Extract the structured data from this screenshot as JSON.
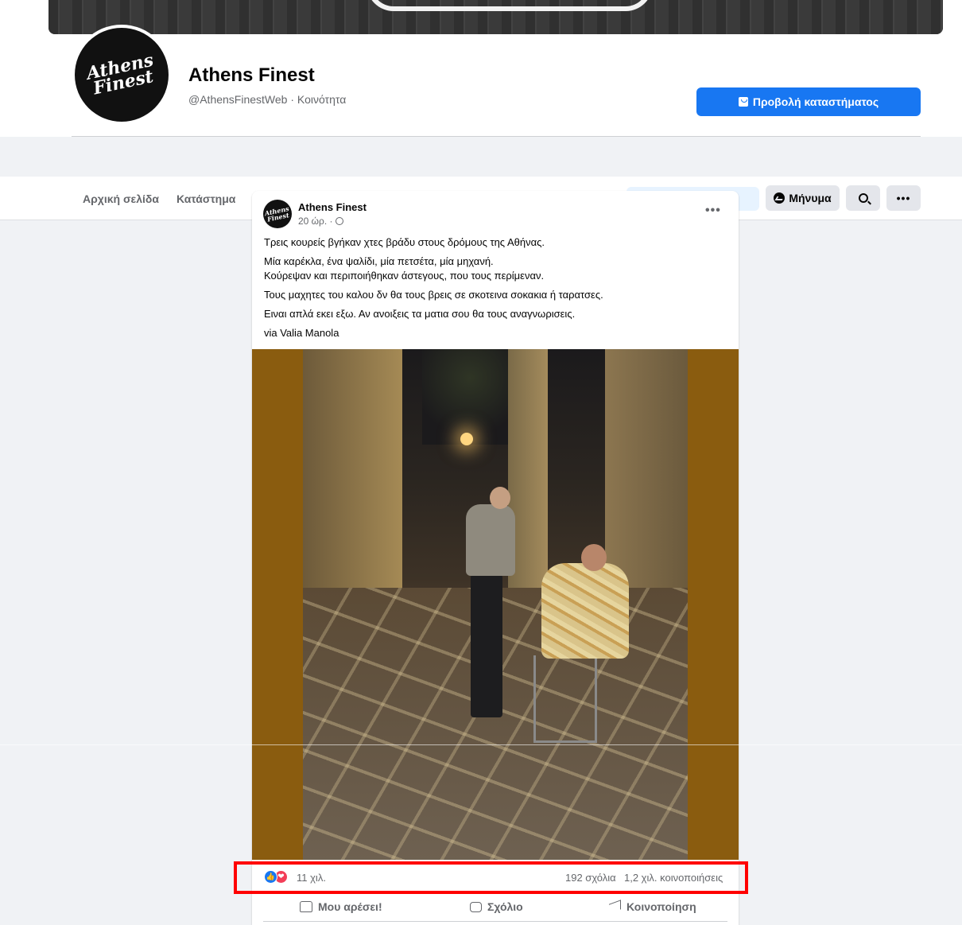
{
  "page": {
    "name": "Athens Finest",
    "handle": "@AthensFinestWeb · Κοινότητα",
    "logo_text": "Athens Finest",
    "shop_button_label": "Προβολή καταστήματος"
  },
  "tabs": {
    "home": "Αρχική σελίδα",
    "shop": "Κατάστημα",
    "message_button": "Μήνυμα",
    "more_label": "•••"
  },
  "post": {
    "author": "Athens Finest",
    "time": "20 ώρ. ·",
    "more_label": "•••",
    "paragraphs": [
      "Τρεις κουρείς βγήκαν χτες βράδυ στους δρόμους της Αθήνας.",
      "Μία καρέκλα, ένα ψαλίδι, μία πετσέτα, μία μηχανή.",
      "Κούρεψαν και περιποιήθηκαν άστεγους, που τους περίμεναν.",
      "Τους μαχητες του καλου δν θα τους βρεις σε σκοτεινα σοκακια ή ταρατσες.",
      "Ειναι απλά εκει εξω. Αν ανοιξεις τα ματια σου θα τους αναγνωρισεις.",
      "via Valia Manola"
    ],
    "reactions_count": "11 χιλ.",
    "comments_count": "192 σχόλια",
    "shares_count": "1,2 χιλ. κοινοποιήσεις",
    "actions": {
      "like": "Μου αρέσει!",
      "comment": "Σχόλιο",
      "share": "Κοινοποίηση"
    }
  },
  "icons": [
    "shop-icon",
    "messenger-icon",
    "search-icon",
    "globe-icon",
    "like-icon",
    "love-icon",
    "thumb-icon",
    "bubble-icon",
    "share-icon"
  ],
  "colors": {
    "accent": "#1877f2",
    "highlight": "#ff0000",
    "photo_background": "#8a5c0f"
  }
}
